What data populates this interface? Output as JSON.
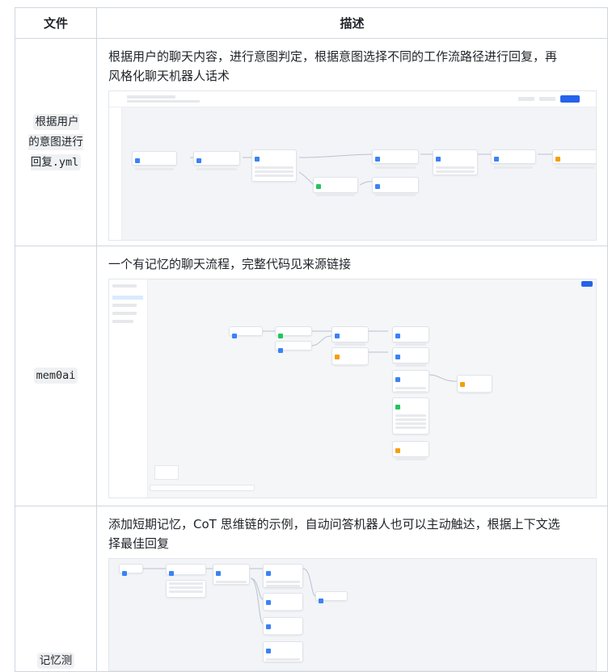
{
  "table": {
    "headers": [
      "文件",
      "描述"
    ],
    "rows": [
      {
        "file": "根据用户的意图进行回复.yml",
        "file_lines": [
          "根据用户",
          "的意图进行",
          "回复.yml"
        ],
        "description": "根据用户的聊天内容，进行意图判定，根据意图选择不同的工作流路径进行回复，再风格化聊天机器人话术",
        "description_lines": [
          "根据用户的聊天内容，进行意图判定，根据意图选择不同的工作流路径进行回复，再",
          "风格化聊天机器人话术"
        ],
        "screenshot": "workflow-intent-routing"
      },
      {
        "file": "mem0ai",
        "file_lines": [
          "mem0ai"
        ],
        "description": "一个有记忆的聊天流程，完整代码见来源链接",
        "description_lines": [
          "一个有记忆的聊天流程，完整代码见来源链接"
        ],
        "screenshot": "workflow-memory-chat"
      },
      {
        "file": "记忆测",
        "file_lines": [
          "记忆测"
        ],
        "description": "添加短期记忆，CoT 思维链的示例，自动问答机器人也可以主动触达，根据上下文选择最佳回复",
        "description_lines": [
          "添加短期记忆，CoT 思维链的示例，自动问答机器人也可以主动触达，根据上下文选",
          "择最佳回复"
        ],
        "screenshot": "workflow-short-term-memory"
      }
    ]
  },
  "colors": {
    "accent": "#2563eb",
    "node_blue": "#3b82f6",
    "node_green": "#22c55e",
    "node_orange": "#f59e0b",
    "border": "#d0d7de"
  }
}
